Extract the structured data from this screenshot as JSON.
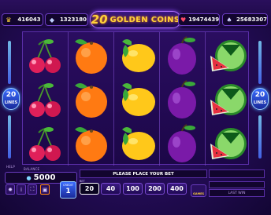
{
  "header": {
    "logo_number": "20",
    "logo_text": "GOLDEN COINS",
    "pills": [
      {
        "icon": "crown-icon",
        "symbol": "♛",
        "value": "416043",
        "color": "#ffd23a"
      },
      {
        "icon": "diamond-icon",
        "symbol": "◆",
        "value": "1323180",
        "color": "#c0d0ff"
      },
      {
        "icon": "heart-icon",
        "symbol": "♥",
        "value": "19474439",
        "color": "#ff4a6a"
      },
      {
        "icon": "spade-icon",
        "symbol": "♠",
        "value": "25683307",
        "color": "#d0d0ff"
      }
    ]
  },
  "lines": {
    "count": "20",
    "label": "LINES"
  },
  "reels": [
    [
      "cherry",
      "cherry",
      "cherry"
    ],
    [
      "orange",
      "orange",
      "orange"
    ],
    [
      "lemon",
      "lemon",
      "lemon"
    ],
    [
      "plum",
      "plum",
      "plum"
    ],
    [
      "watermelon",
      "watermelon",
      "watermelon"
    ]
  ],
  "footer": {
    "help_label": "HELP",
    "balance_label": "BALANCE",
    "balance": "5000",
    "message": "PLEASE PLACE YOUR BET",
    "credit_label": "CREDIT",
    "credit_value": "1",
    "bet_label": "BET",
    "bets": [
      "20",
      "40",
      "100",
      "200",
      "400"
    ],
    "active_bet": "20",
    "games_label": "GAMES",
    "last_win_label": "LAST WIN"
  },
  "colors": {
    "accent": "#ffd23a",
    "lines_badge": "#3a6cff",
    "background": "#230c55"
  }
}
